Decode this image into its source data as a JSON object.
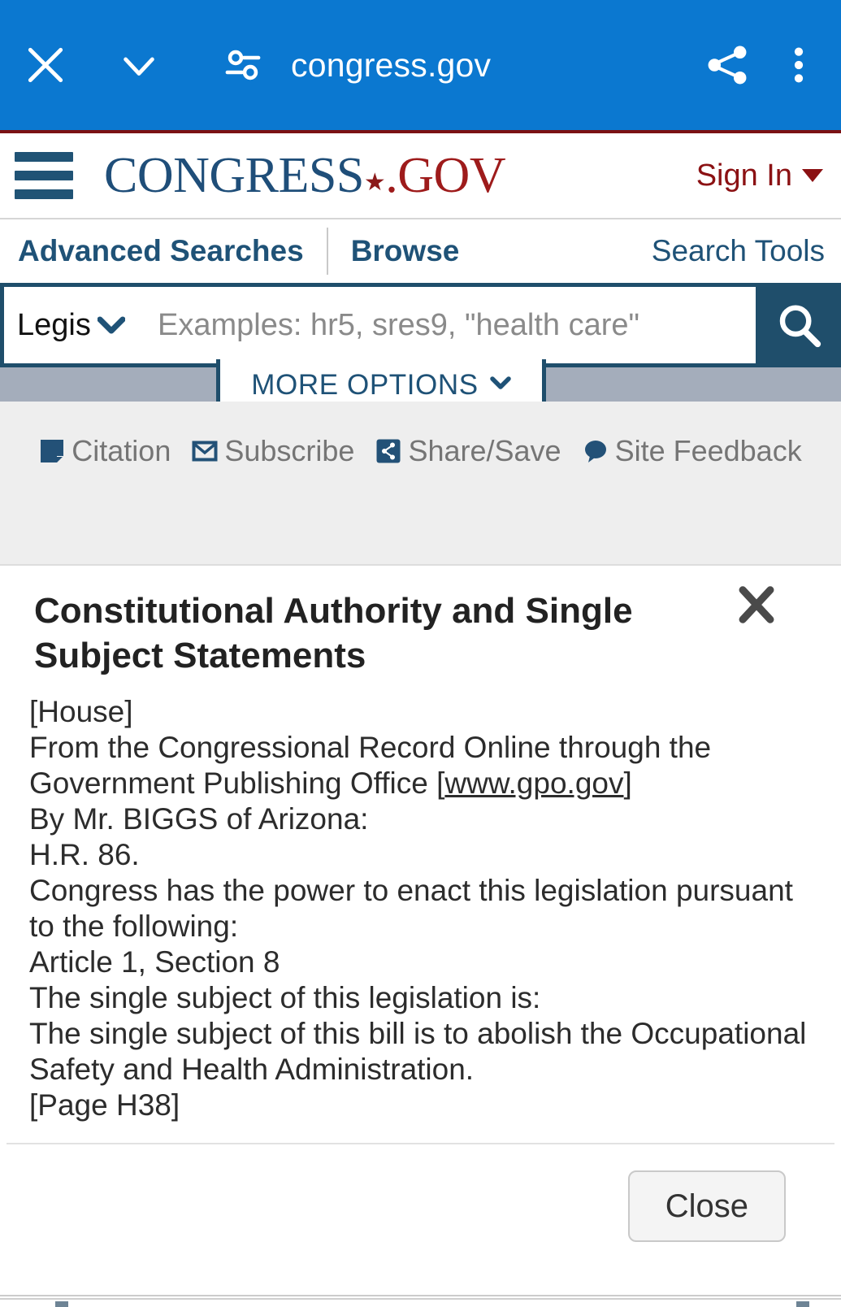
{
  "browser_bar": {
    "close_icon": "close-icon",
    "chevron_icon": "chevron-down-icon",
    "page_info_icon": "page-info-tune-icon",
    "url": "congress.gov",
    "share_icon": "share-icon",
    "overflow_icon": "overflow-menu-icon",
    "background_color": "#0B78D0"
  },
  "site_header": {
    "menu_icon": "hamburger-menu-icon",
    "brand_part1": "CONGRESS",
    "brand_star": "★",
    "brand_part2": ".GOV",
    "brand_color_primary": "#1f4e79",
    "brand_color_accent": "#9e1b1b",
    "sign_in_label": "Sign In",
    "accent_red": "#7b1113"
  },
  "nav": {
    "advanced_searches": "Advanced Searches",
    "browse": "Browse",
    "search_tools": "Search Tools",
    "link_color": "#1f5277"
  },
  "search": {
    "scope_value": "Legis",
    "scope_chevron": "chevron-down-icon",
    "placeholder": "Examples: hr5, sres9, \"health care\"",
    "search_icon": "search-icon",
    "more_options_label": "MORE OPTIONS",
    "more_options_chevron": "chevron-down-icon",
    "border_color": "#1f4e6b",
    "strip_color": "#a4adbb"
  },
  "utility_bar": {
    "items": [
      {
        "label": "Citation",
        "icon": "citation-page-icon"
      },
      {
        "label": "Subscribe",
        "icon": "envelope-icon"
      },
      {
        "label": "Share/Save",
        "icon": "share-icon"
      },
      {
        "label": "Site Feedback",
        "icon": "speech-bubble-icon"
      }
    ],
    "text_color": "#757575",
    "icon_color": "#235177",
    "background_color": "#eeeeee"
  },
  "modal": {
    "title": "Constitutional Authority and Single Subject Statements",
    "close_icon": "close-icon",
    "body_lines": [
      "[House]",
      "From the Congressional Record Online through the Government Publishing Office [",
      "By Mr. BIGGS of Arizona:",
      "H.R. 86.",
      "Congress has the power to enact this legislation pursuant to the following:",
      "Article 1, Section 8",
      "The single subject of this legislation is:",
      "The single subject of this bill is to abolish the Occupational Safety and Health Administration.",
      "[Page H38]"
    ],
    "line_house": "[House]",
    "line_source_pre": "From the Congressional Record Online through the Government Publishing Office [",
    "line_source_link": "www.gpo.gov",
    "line_source_post": "]",
    "line_sponsor": "By Mr. BIGGS of Arizona:",
    "line_bill": "H.R. 86.",
    "line_authority_intro": "Congress has the power to enact this legislation pursuant to the following:",
    "line_article": "Article 1, Section 8",
    "line_subject_intro": "The single subject of this legislation is:",
    "line_subject": "The single subject of this bill is to abolish the Occupational Safety and Health Administration.",
    "line_page": "[Page H38]",
    "close_button_label": "Close"
  }
}
